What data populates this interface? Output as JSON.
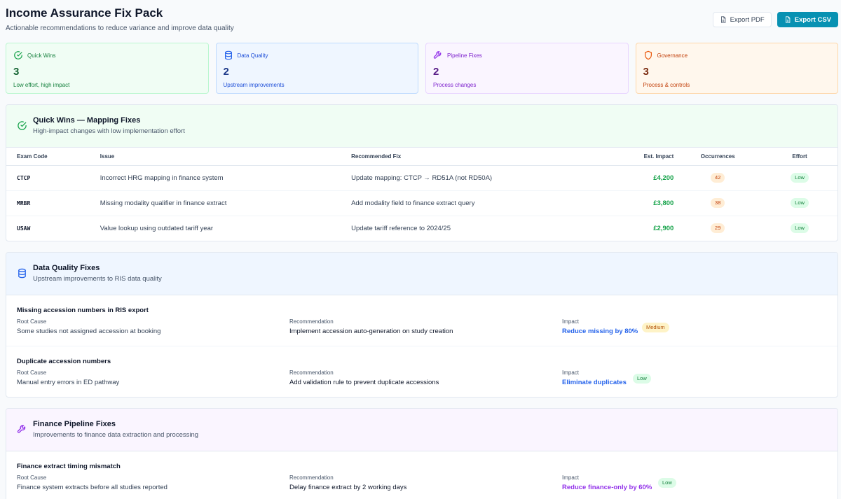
{
  "header": {
    "title": "Income Assurance Fix Pack",
    "subtitle": "Actionable recommendations to reduce variance and improve data quality",
    "export_pdf": "Export PDF",
    "export_csv": "Export CSV"
  },
  "cards": [
    {
      "label": "Quick Wins",
      "value": "3",
      "desc": "Low effort, high impact",
      "icon": "check-circle-icon"
    },
    {
      "label": "Data Quality",
      "value": "2",
      "desc": "Upstream improvements",
      "icon": "database-icon"
    },
    {
      "label": "Pipeline Fixes",
      "value": "2",
      "desc": "Process changes",
      "icon": "wrench-icon"
    },
    {
      "label": "Governance",
      "value": "3",
      "desc": "Process & controls",
      "icon": "shield-icon"
    }
  ],
  "quick_wins": {
    "title": "Quick Wins — Mapping Fixes",
    "subtitle": "High-impact changes with low implementation effort",
    "columns": [
      "Exam Code",
      "Issue",
      "Recommended Fix",
      "Est. Impact",
      "Occurrences",
      "Effort"
    ],
    "rows": [
      {
        "code": "CTCP",
        "issue": "Incorrect HRG mapping in finance system",
        "fix": "Update mapping: CTCP → RD51A (not RD50A)",
        "impact": "£4,200",
        "occurrences": "42",
        "effort": "Low"
      },
      {
        "code": "MRBR",
        "issue": "Missing modality qualifier in finance extract",
        "fix": "Add modality field to finance extract query",
        "impact": "£3,800",
        "occurrences": "38",
        "effort": "Low"
      },
      {
        "code": "USAW",
        "issue": "Value lookup using outdated tariff year",
        "fix": "Update tariff reference to 2024/25",
        "impact": "£2,900",
        "occurrences": "29",
        "effort": "Low"
      }
    ]
  },
  "data_quality": {
    "title": "Data Quality Fixes",
    "subtitle": "Upstream improvements to RIS data quality",
    "root_cause_label": "Root Cause",
    "recommendation_label": "Recommendation",
    "impact_label": "Impact",
    "items": [
      {
        "title": "Missing accession numbers in RIS export",
        "root_cause": "Some studies not assigned accession at booking",
        "recommendation": "Implement accession auto-generation on study creation",
        "impact": "Reduce missing by 80%",
        "effort": "Medium"
      },
      {
        "title": "Duplicate accession numbers",
        "root_cause": "Manual entry errors in ED pathway",
        "recommendation": "Add validation rule to prevent duplicate accessions",
        "impact": "Eliminate duplicates",
        "effort": "Low"
      }
    ]
  },
  "pipeline": {
    "title": "Finance Pipeline Fixes",
    "subtitle": "Improvements to finance data extraction and processing",
    "root_cause_label": "Root Cause",
    "recommendation_label": "Recommendation",
    "impact_label": "Impact",
    "items": [
      {
        "title": "Finance extract timing mismatch",
        "root_cause": "Finance system extracts before all studies reported",
        "recommendation": "Delay finance extract by 2 working days",
        "impact": "Reduce finance-only by 60%",
        "effort": "Low"
      }
    ]
  },
  "colors": {
    "accent": "#0891b2",
    "green": "#16a34a",
    "blue": "#2563eb",
    "purple": "#9333ea",
    "orange": "#ea580c"
  }
}
